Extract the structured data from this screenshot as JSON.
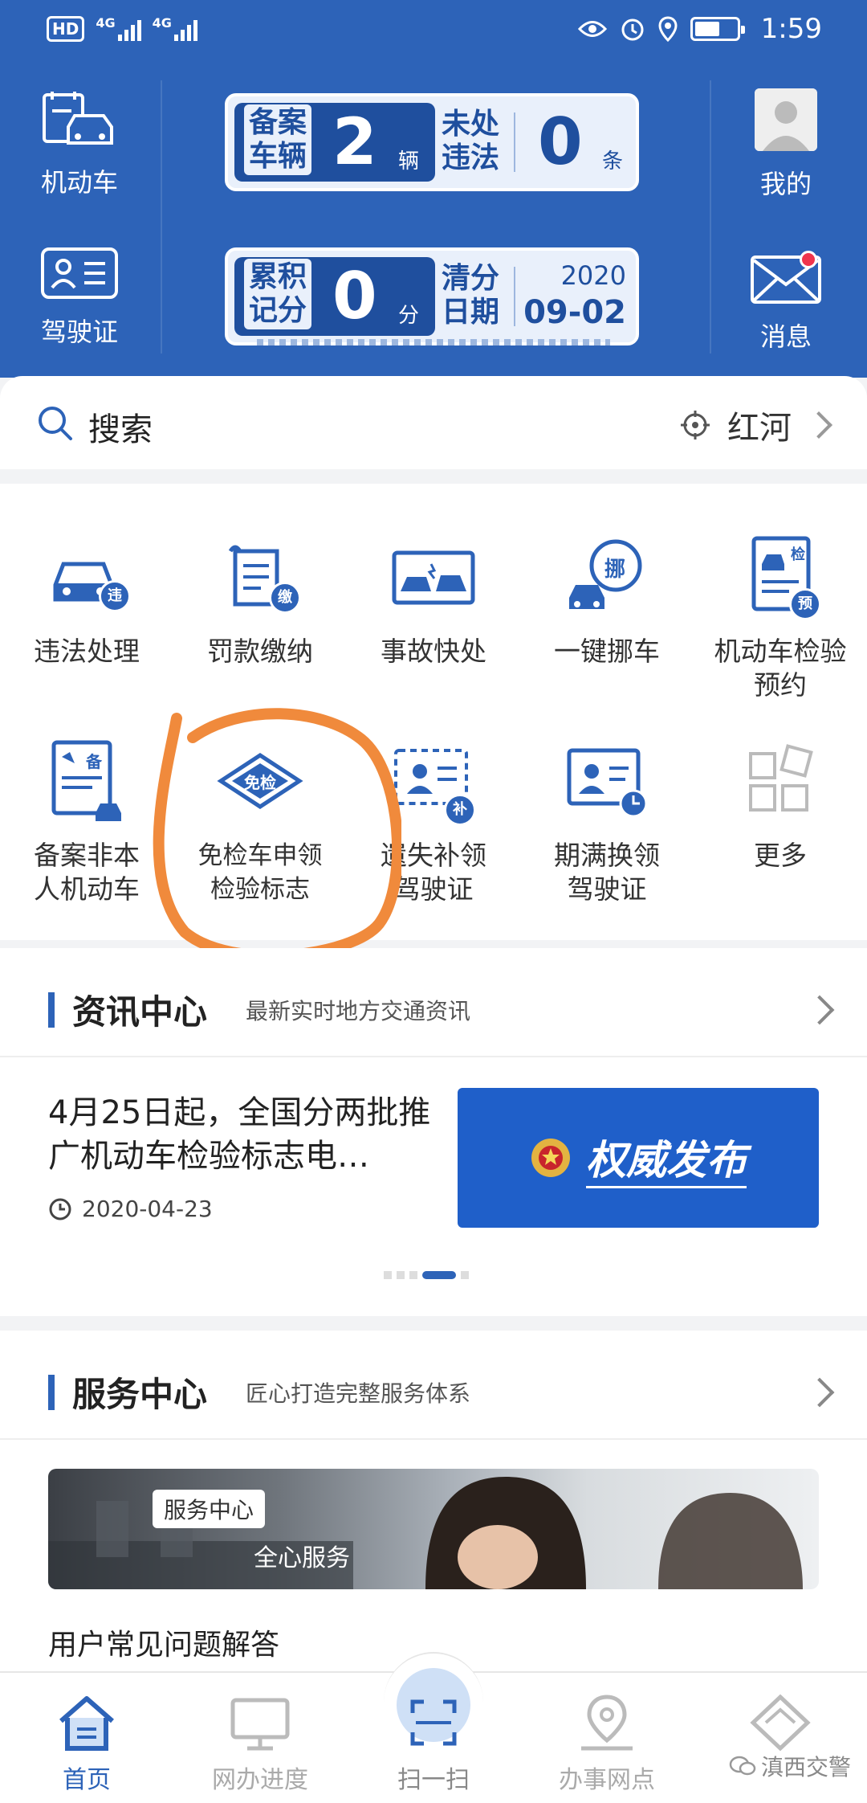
{
  "status_bar": {
    "left": [
      "HD",
      "4G",
      "4G"
    ],
    "time": "1:59"
  },
  "header": {
    "vehicle_label": "机动车",
    "license_label": "驾驶证",
    "profile_label": "我的",
    "message_label": "消息",
    "vehicle_panel": {
      "registered_label_1": "备案",
      "registered_label_2": "车辆",
      "registered_count": "2",
      "registered_unit": "辆",
      "violation_label_1": "未处",
      "violation_label_2": "违法",
      "violation_count": "0",
      "violation_unit": "条"
    },
    "license_panel": {
      "points_label_1": "累积",
      "points_label_2": "记分",
      "points_value": "0",
      "points_unit": "分",
      "clear_label_1": "清分",
      "clear_label_2": "日期",
      "clear_year": "2020",
      "clear_date": "09-02"
    }
  },
  "search": {
    "placeholder": "搜索",
    "location": "红河"
  },
  "services": [
    {
      "label": "违法处理",
      "badge": "违",
      "icon": "car-violation-icon"
    },
    {
      "label": "罚款缴纳",
      "badge": "缴",
      "icon": "fine-payment-icon"
    },
    {
      "label": "事故快处",
      "badge": "",
      "icon": "accident-icon"
    },
    {
      "label": "一键挪车",
      "badge": "挪",
      "icon": "move-car-icon"
    },
    {
      "label": "机动车检验预约",
      "badge": "预",
      "badge_top": "检",
      "icon": "inspection-booking-icon"
    },
    {
      "label": "备案非本人机动车",
      "badge": "备",
      "icon": "register-vehicle-icon"
    },
    {
      "label": "免检车申领检验标志",
      "badge": "免检",
      "icon": "exempt-label-icon"
    },
    {
      "label": "遗失补领驾驶证",
      "badge": "补",
      "icon": "lost-license-icon"
    },
    {
      "label": "期满换领驾驶证",
      "badge": "",
      "icon": "renew-license-icon"
    },
    {
      "label": "更多",
      "badge": "",
      "icon": "more-icon"
    }
  ],
  "news": {
    "title": "资讯中心",
    "subtitle": "最新实时地方交通资讯",
    "headline": "4月25日起，全国分两批推广机动车检验标志电…",
    "date": "2020-04-23",
    "banner_text": "权威发布"
  },
  "service_center": {
    "title": "服务中心",
    "subtitle": "匠心打造完整服务体系",
    "banner_tag": "服务中心",
    "banner_slogan": "全心服务",
    "faq": "用户常见问题解答"
  },
  "bottom_nav": {
    "home": "首页",
    "progress": "网办进度",
    "scan": "扫一扫",
    "outlets": "办事网点",
    "mine": ""
  },
  "watermark": "滇西交警",
  "colors": {
    "primary": "#2d63b8",
    "panel_dark": "#1f4f9e",
    "panel_light": "#e9f0fb",
    "badge_red": "#f0354d",
    "annotation_orange": "#f08a3c"
  }
}
